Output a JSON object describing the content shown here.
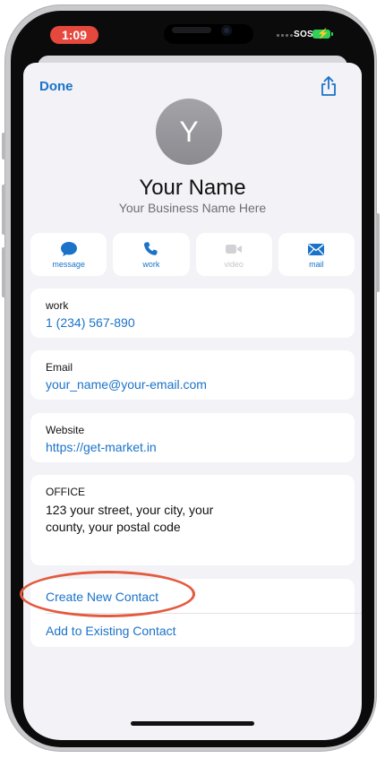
{
  "status_bar": {
    "time": "1:09",
    "carrier": "SOS"
  },
  "nav": {
    "done_label": "Done"
  },
  "contact": {
    "initial": "Y",
    "name": "Your Name",
    "company": "Your Business Name Here"
  },
  "actions": [
    {
      "label": "message",
      "icon": "message-bubble-icon",
      "enabled": true
    },
    {
      "label": "work",
      "icon": "phone-icon",
      "enabled": true
    },
    {
      "label": "video",
      "icon": "video-camera-icon",
      "enabled": false
    },
    {
      "label": "mail",
      "icon": "envelope-icon",
      "enabled": true
    }
  ],
  "fields": {
    "phone": {
      "label": "work",
      "value": "1 (234) 567-890"
    },
    "email": {
      "label": "Email",
      "value": "your_name@your-email.com"
    },
    "website": {
      "label": "Website",
      "value": "https://get-market.in"
    },
    "address": {
      "label": "OFFICE",
      "line1": "123 your street, your city, your",
      "line2": "county, your postal code"
    }
  },
  "contact_actions": {
    "create": "Create New Contact",
    "add": "Add to Existing Contact"
  },
  "colors": {
    "accent": "#1a73c9",
    "highlight_ring": "#e45a3e",
    "status_time": "#e5483c",
    "battery": "#2fd158"
  }
}
